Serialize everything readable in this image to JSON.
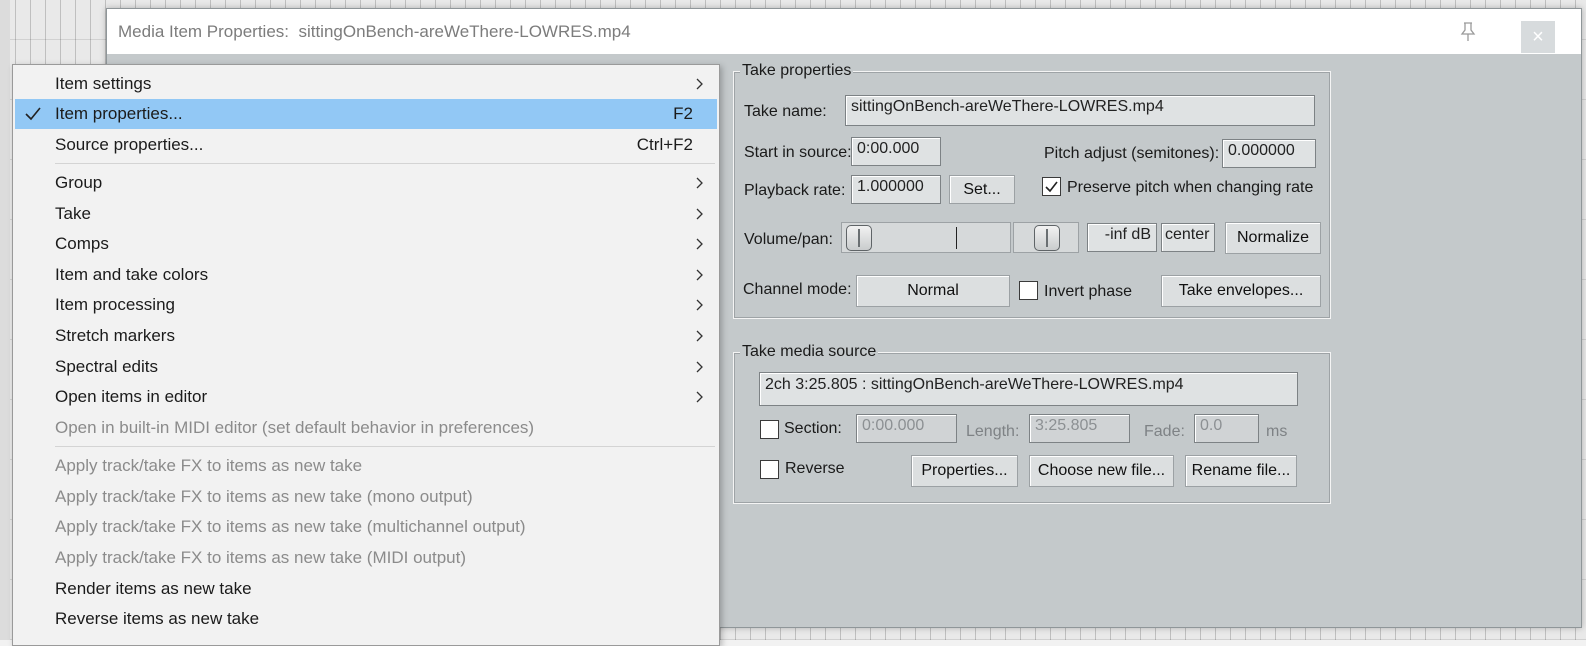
{
  "dialog": {
    "title": "Media Item Properties:  sittingOnBench-areWeThere-LOWRES.mp4",
    "close_label": "×"
  },
  "take_properties": {
    "group_label": "Take properties",
    "take_name_label": "Take name:",
    "take_name_value": "sittingOnBench-areWeThere-LOWRES.mp4",
    "start_in_source_label": "Start in source:",
    "start_in_source_value": "0:00.000",
    "pitch_adjust_label": "Pitch adjust (semitones):",
    "pitch_adjust_value": "0.000000",
    "playback_rate_label": "Playback rate:",
    "playback_rate_value": "1.000000",
    "set_button": "Set...",
    "preserve_pitch_label": "Preserve pitch when changing rate",
    "preserve_pitch_checked": true,
    "volume_pan_label": "Volume/pan:",
    "volume_value": "-inf dB",
    "pan_value": "center",
    "normalize_button": "Normalize",
    "channel_mode_label": "Channel mode:",
    "channel_mode_value": "Normal",
    "invert_phase_label": "Invert phase",
    "invert_phase_checked": false,
    "take_envelopes_button": "Take envelopes..."
  },
  "take_media_source": {
    "group_label": "Take media source",
    "source_info": "2ch 3:25.805 : sittingOnBench-areWeThere-LOWRES.mp4",
    "section_label": "Section:",
    "section_checked": false,
    "section_value": "0:00.000",
    "length_label": "Length:",
    "length_value": "3:25.805",
    "fade_label": "Fade:",
    "fade_value": "0.0",
    "fade_unit": "ms",
    "reverse_label": "Reverse",
    "reverse_checked": false,
    "properties_button": "Properties...",
    "choose_file_button": "Choose new file...",
    "rename_file_button": "Rename file..."
  },
  "context_menu": {
    "items": [
      {
        "label": "Item settings",
        "submenu": true
      },
      {
        "label": "Item properties...",
        "shortcut": "F2",
        "checked": true,
        "selected": true
      },
      {
        "label": "Source properties...",
        "shortcut": "Ctrl+F2"
      },
      {
        "label": "Group",
        "submenu": true
      },
      {
        "label": "Take",
        "submenu": true
      },
      {
        "label": "Comps",
        "submenu": true
      },
      {
        "label": "Item and take colors",
        "submenu": true
      },
      {
        "label": "Item processing",
        "submenu": true
      },
      {
        "label": "Stretch markers",
        "submenu": true
      },
      {
        "label": "Spectral edits",
        "submenu": true
      },
      {
        "label": "Open items in editor",
        "submenu": true
      },
      {
        "label": "Open in built-in MIDI editor (set default behavior in preferences)",
        "disabled": true
      },
      {
        "label": "Apply track/take FX to items as new take",
        "disabled": true
      },
      {
        "label": "Apply track/take FX to items as new take (mono output)",
        "disabled": true
      },
      {
        "label": "Apply track/take FX to items as new take (multichannel output)",
        "disabled": true
      },
      {
        "label": "Apply track/take FX to items as new take (MIDI output)",
        "disabled": true
      },
      {
        "label": "Render items as new take"
      },
      {
        "label": "Reverse items as new take"
      }
    ]
  }
}
